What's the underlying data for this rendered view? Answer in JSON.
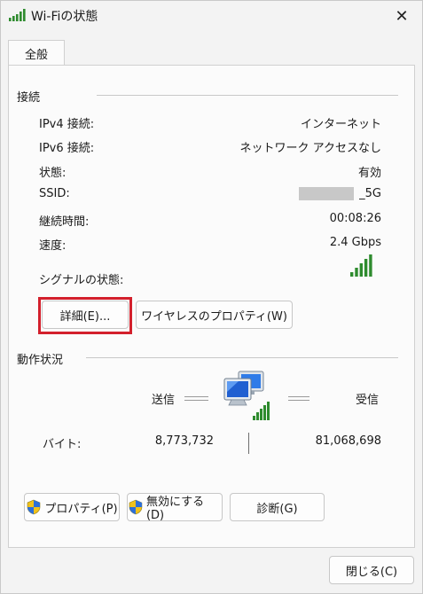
{
  "window": {
    "title": "Wi-Fiの状態",
    "close_label": "✕"
  },
  "tab": {
    "label": "全般"
  },
  "connection": {
    "heading": "接続",
    "rows": [
      {
        "label": "IPv4 接続:",
        "value": "インターネット"
      },
      {
        "label": "IPv6 接続:",
        "value": "ネットワーク アクセスなし"
      },
      {
        "label": "状態:",
        "value": "有効"
      },
      {
        "label": "SSID:",
        "value": "_5G"
      },
      {
        "label": "継続時間:",
        "value": "00:08:26"
      },
      {
        "label": "速度:",
        "value": "2.4 Gbps"
      }
    ],
    "signal_label": "シグナルの状態:",
    "signal_bars": 5,
    "details_button": "詳細(E)...",
    "wireless_button": "ワイヤレスのプロパティ(W)"
  },
  "activity": {
    "heading": "動作状況",
    "sent_label": "送信",
    "received_label": "受信",
    "bytes_label": "バイト:",
    "bytes_sent": "8,773,732",
    "bytes_received": "81,068,698"
  },
  "actions": {
    "properties_button": "プロパティ(P)",
    "disable_button": "無効にする(D)",
    "diagnose_button": "診断(G)"
  },
  "footer": {
    "close_button": "閉じる(C)"
  },
  "colors": {
    "highlight": "#d3202c",
    "signal": "#2e8b2e",
    "monitor": "#1f5fd1"
  }
}
